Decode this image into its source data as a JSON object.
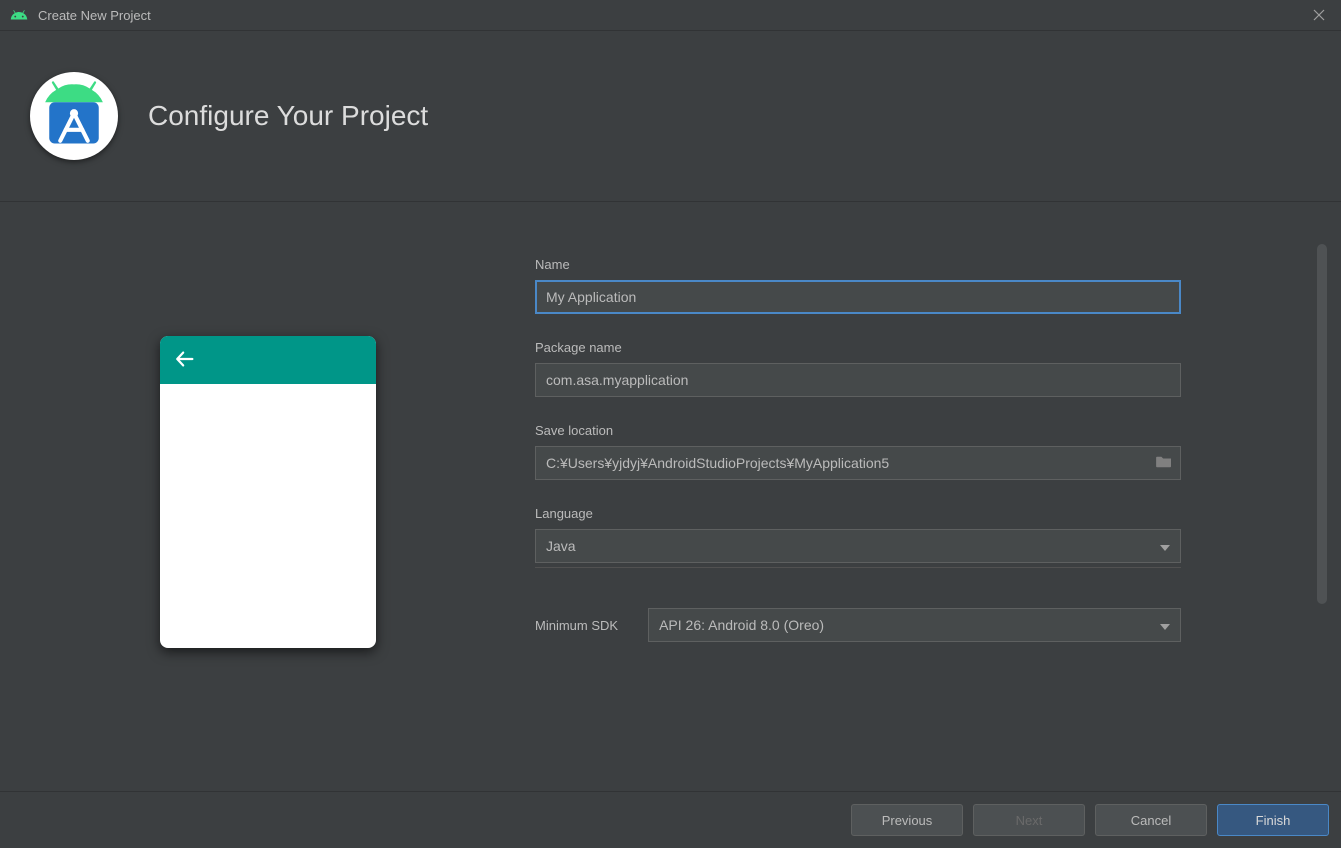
{
  "titlebar": {
    "title": "Create New Project"
  },
  "header": {
    "title": "Configure Your Project"
  },
  "form": {
    "name": {
      "label": "Name",
      "value": "My Application"
    },
    "package": {
      "label": "Package name",
      "value": "com.asa.myapplication"
    },
    "save_location": {
      "label": "Save location",
      "value": "C:¥Users¥yjdyj¥AndroidStudioProjects¥MyApplication5"
    },
    "language": {
      "label": "Language",
      "value": "Java"
    },
    "minimum_sdk": {
      "label": "Minimum SDK",
      "value": "API 26: Android 8.0 (Oreo)"
    }
  },
  "footer": {
    "previous": "Previous",
    "next": "Next",
    "cancel": "Cancel",
    "finish": "Finish"
  }
}
